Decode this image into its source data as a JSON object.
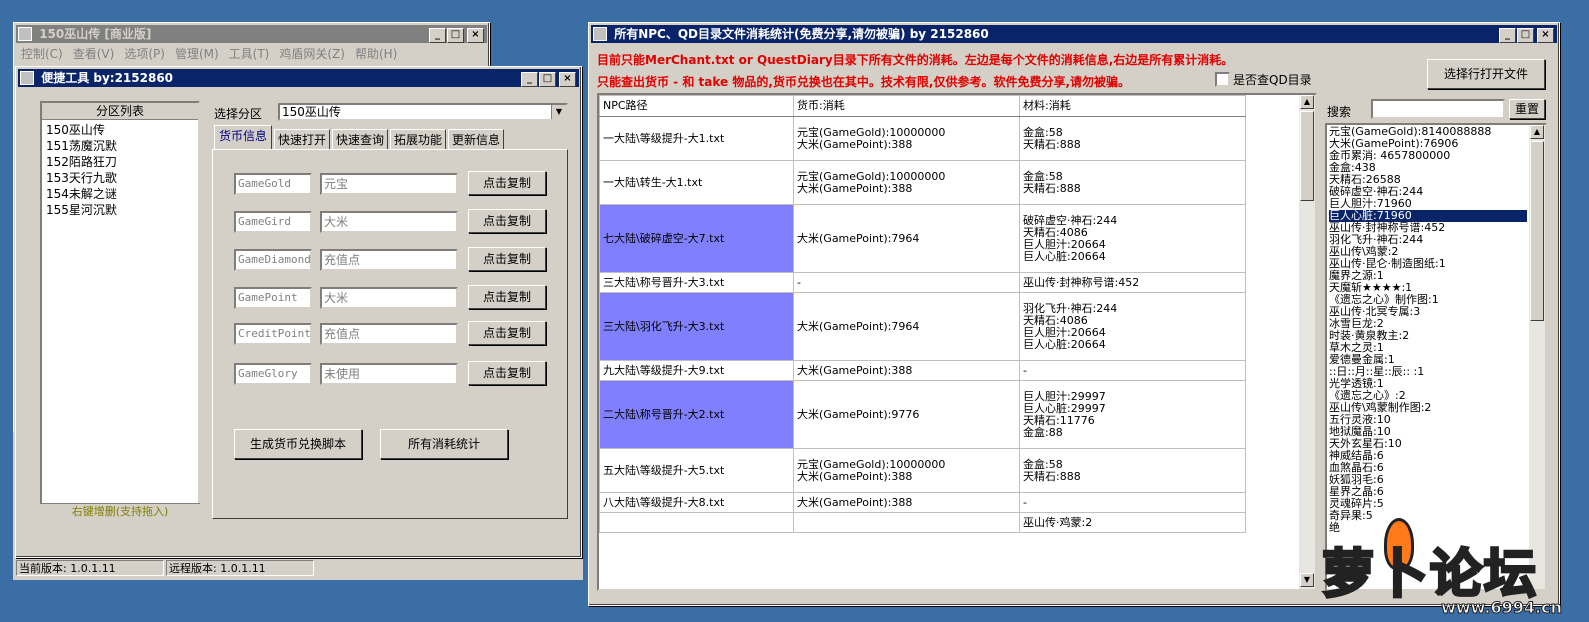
{
  "main_window": {
    "title": "150巫山传 [商业版]",
    "menu": [
      "控制(C)",
      "查看(V)",
      "选项(P)",
      "管理(M)",
      "工具(T)",
      "鸡盾网关(Z)",
      "帮助(H)"
    ],
    "status_current": "当前版本: 1.0.1.11",
    "status_remote": "远程版本: 1.0.1.11"
  },
  "tool_window": {
    "title": "便捷工具   by:2152860",
    "partition_list_header": "分区列表",
    "partitions": [
      "150巫山传",
      "151荡魔沉默",
      "152陌路狂刀",
      "153天行九歌",
      "154未解之谜",
      "155星河沉默"
    ],
    "partition_hint": "右键增删(支持拖入)",
    "select_label": "选择分区",
    "select_value": "150巫山传",
    "tabs": [
      "货币信息",
      "快速打开",
      "快速查询",
      "拓展功能",
      "更新信息"
    ],
    "currency_rows": [
      {
        "code": "GameGold",
        "name": "元宝",
        "button": "点击复制"
      },
      {
        "code": "GameGird",
        "name": "大米",
        "button": "点击复制"
      },
      {
        "code": "GameDiamond",
        "name": "充值点",
        "button": "点击复制"
      },
      {
        "code": "GamePoint",
        "name": "大米",
        "button": "点击复制"
      },
      {
        "code": "CreditPoint",
        "name": "充值点",
        "button": "点击复制"
      },
      {
        "code": "GameGlory",
        "name": "未使用",
        "button": "点击复制"
      }
    ],
    "btn_generate": "生成货币兑换脚本",
    "btn_all": "所有消耗统计"
  },
  "stats_window": {
    "title": "所有NPC、QD目录文件消耗统计(免费分享,请勿被骗)     by 2152860",
    "notice1": "目前只能MerChant.txt or QuestDiary目录下所有文件的消耗。左边是每个文件的消耗信息,右边是所有累计消耗。",
    "notice2": "只能查出货币 - 和 take 物品的,货币兑换也在其中。技术有限,仅供参考。软件免费分享,请勿被骗。",
    "checkbox_label": "是否查QD目录",
    "btn_open": "选择行打开文件",
    "search_label": "搜索",
    "btn_reset": "重置",
    "headers": [
      "NPC路径",
      "货币:消耗",
      "材料:消耗"
    ],
    "rows": [
      {
        "path": "一大陆\\等级提升-大1.txt",
        "currency": [
          "元宝(GameGold):10000000",
          "大米(GamePoint):388"
        ],
        "material": [
          "金盒:58",
          "天精石:888"
        ],
        "hl": false
      },
      {
        "path": "一大陆\\转生-大1.txt",
        "currency": [
          "元宝(GameGold):10000000",
          "大米(GamePoint):388"
        ],
        "material": [
          "金盒:58",
          "天精石:888"
        ],
        "hl": false
      },
      {
        "path": "七大陆\\破碎虚空-大7.txt",
        "currency": [
          "大米(GamePoint):7964"
        ],
        "material": [
          "破碎虚空·神石:244",
          "天精石:4086",
          "巨人胆汁:20664",
          "巨人心脏:20664"
        ],
        "hl": true
      },
      {
        "path": "三大陆\\称号晋升-大3.txt",
        "currency": [
          "-"
        ],
        "material": [
          "巫山传·封神称号谱:452"
        ],
        "hl": false
      },
      {
        "path": "三大陆\\羽化飞升-大3.txt",
        "currency": [
          "大米(GamePoint):7964"
        ],
        "material": [
          "羽化飞升·神石:244",
          "天精石:4086",
          "巨人胆汁:20664",
          "巨人心脏:20664"
        ],
        "hl": true
      },
      {
        "path": "九大陆\\等级提升-大9.txt",
        "currency": [
          "大米(GamePoint):388"
        ],
        "material": [
          "-"
        ],
        "hl": false
      },
      {
        "path": "二大陆\\称号晋升-大2.txt",
        "currency": [
          "大米(GamePoint):9776"
        ],
        "material": [
          "巨人胆汁:29997",
          "巨人心脏:29997",
          "天精石:11776",
          "金盒:88"
        ],
        "hl": true
      },
      {
        "path": "五大陆\\等级提升-大5.txt",
        "currency": [
          "元宝(GameGold):10000000",
          "大米(GamePoint):388"
        ],
        "material": [
          "金盒:58",
          "天精石:888"
        ],
        "hl": false
      },
      {
        "path": "八大陆\\等级提升-大8.txt",
        "currency": [
          "大米(GamePoint):388"
        ],
        "material": [
          "-"
        ],
        "hl": false
      },
      {
        "path": "",
        "currency": [
          ""
        ],
        "material": [
          "巫山传·鸡蒙:2"
        ],
        "hl": false
      }
    ],
    "totals": [
      "元宝(GameGold):8140088888",
      "大米(GamePoint):76906",
      "金币累消: 4657800000",
      "金盒:438",
      "天精石:26588",
      "破碎虚空·神石:244",
      "巨人胆汁:71960",
      "巨人心脏:71960",
      "巫山传·封神称号谱:452",
      "羽化飞升·神石:244",
      "巫山传\\鸡蒙:2",
      "巫山传·昆仑·制造图纸:1",
      "魔界之源:1",
      "天魔斩★★★★:1",
      "《遗忘之心》制作图:1",
      "巫山传·北冥专属:3",
      "冰雪巨龙:2",
      "时装·黄泉教主:2",
      "草木之灵:1",
      "爱德曼金属:1",
      "::日::月::星::辰:: :1",
      "光学透镜:1",
      "《遗忘之心》:2",
      "巫山传\\鸡蒙制作图:2",
      "五行灵液:10",
      "地狱魔晶:10",
      "天外玄星石:10",
      "神威结晶:6",
      "血煞晶石:6",
      "妖狐羽毛:6",
      "星界之晶:6",
      "灵魂碎片:5",
      "奇异果:5",
      "绝"
    ],
    "totals_selected_index": 7
  },
  "watermark": {
    "text": "萝卜论坛",
    "site": "www.6994.cn"
  }
}
